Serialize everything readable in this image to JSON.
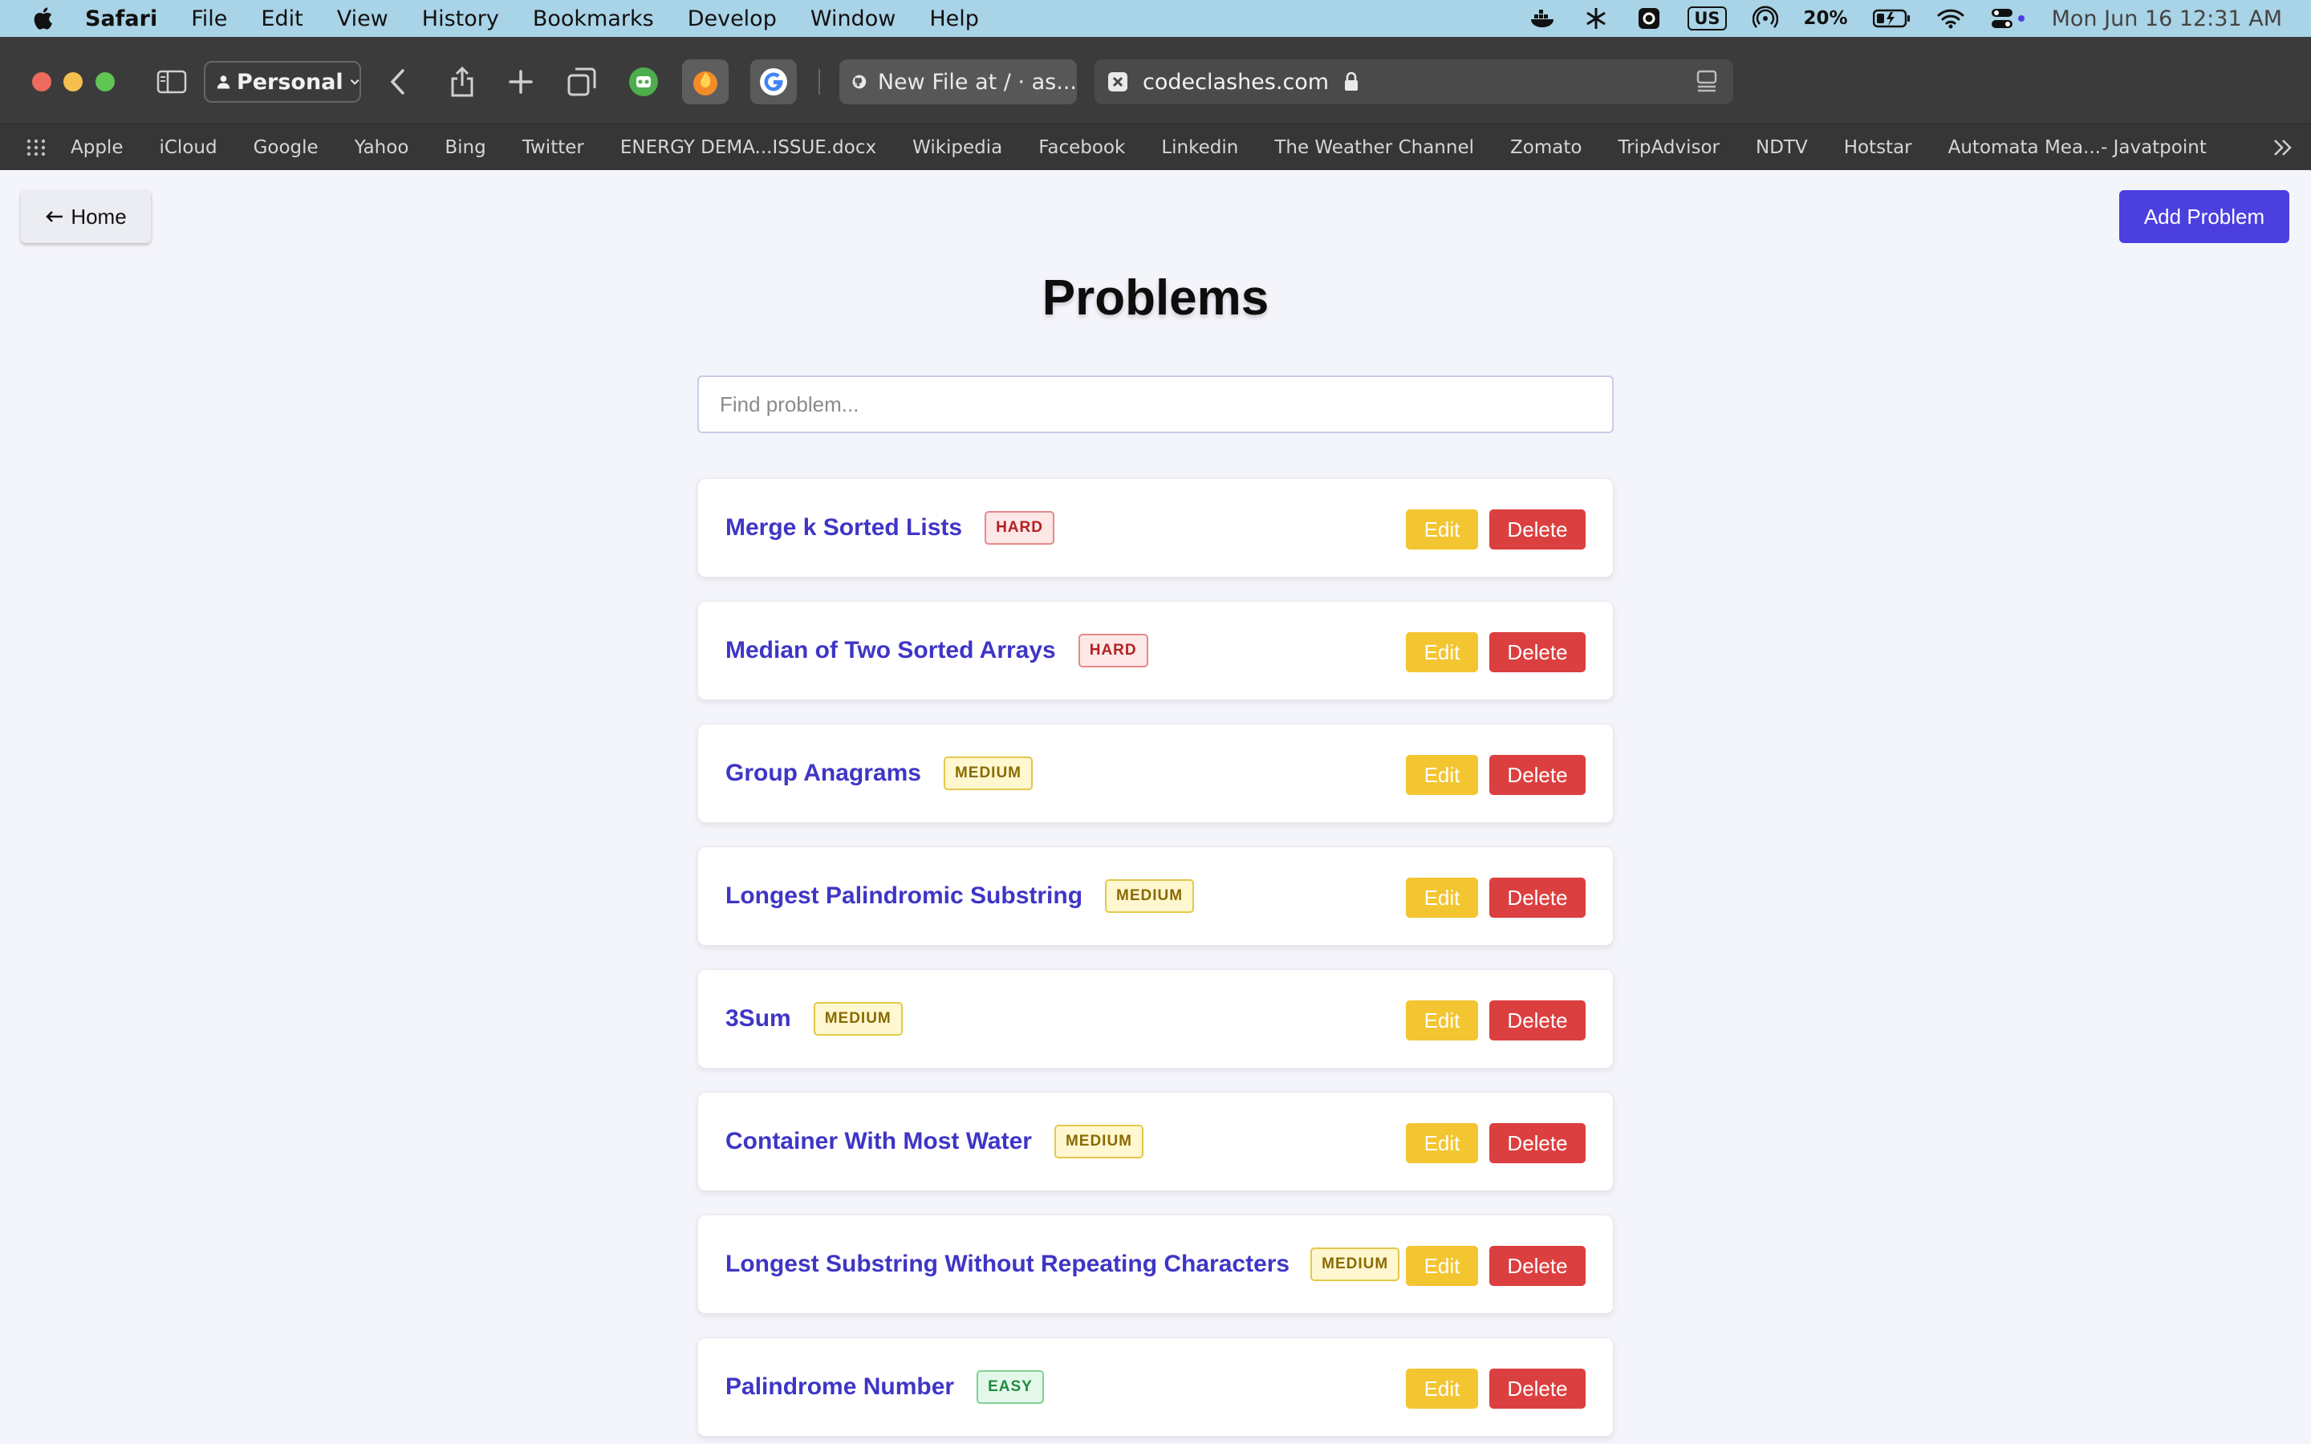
{
  "menubar": {
    "app": "Safari",
    "items": [
      "File",
      "Edit",
      "View",
      "History",
      "Bookmarks",
      "Develop",
      "Window",
      "Help"
    ],
    "input_source": "US",
    "battery": "20%",
    "clock": "Mon Jun 16  12:31 AM"
  },
  "toolbar": {
    "profile": "Personal",
    "tab_title": "New File at / · as...",
    "address": "codeclashes.com"
  },
  "favorites": [
    "Apple",
    "iCloud",
    "Google",
    "Yahoo",
    "Bing",
    "Twitter",
    "ENERGY DEMA...ISSUE.docx",
    "Wikipedia",
    "Facebook",
    "Linkedin",
    "The Weather Channel",
    "Zomato",
    "TripAdvisor",
    "NDTV",
    "Hotstar",
    "Automata Mea...- Javatpoint"
  ],
  "page": {
    "home_label": "Home",
    "add_label": "Add Problem",
    "title": "Problems",
    "search_placeholder": "Find problem...",
    "edit_label": "Edit",
    "delete_label": "Delete",
    "problems": [
      {
        "name": "Merge k Sorted Lists",
        "difficulty": "HARD"
      },
      {
        "name": "Median of Two Sorted Arrays",
        "difficulty": "HARD"
      },
      {
        "name": "Group Anagrams",
        "difficulty": "MEDIUM"
      },
      {
        "name": "Longest Palindromic Substring",
        "difficulty": "MEDIUM"
      },
      {
        "name": "3Sum",
        "difficulty": "MEDIUM"
      },
      {
        "name": "Container With Most Water",
        "difficulty": "MEDIUM"
      },
      {
        "name": "Longest Substring Without Repeating Characters",
        "difficulty": "MEDIUM"
      },
      {
        "name": "Palindrome Number",
        "difficulty": "EASY"
      }
    ]
  },
  "colors": {
    "primary": "#4b3fe0",
    "problem_link": "#3f35c6",
    "edit": "#f3c531",
    "delete": "#dc3f3f"
  }
}
